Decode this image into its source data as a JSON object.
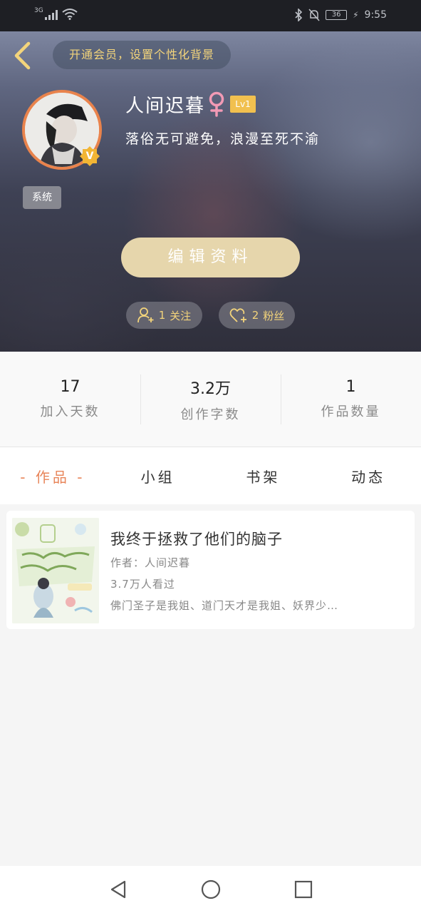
{
  "status_bar": {
    "network": "3G",
    "battery": "36",
    "time": "9:55"
  },
  "header": {
    "vip_promo": "开通会员，设置个性化背景"
  },
  "profile": {
    "nickname": "人间迟暮",
    "level": "Lv1",
    "signature": "落俗无可避免，浪漫至死不渝",
    "tag": "系统",
    "verified_badge": "V",
    "edit_button": "编辑资料",
    "follow_count": "1",
    "follow_label": "关注",
    "fans_count": "2",
    "fans_label": "粉丝"
  },
  "stats": [
    {
      "value": "17",
      "label": "加入天数"
    },
    {
      "value": "3.2万",
      "label": "创作字数"
    },
    {
      "value": "1",
      "label": "作品数量"
    }
  ],
  "tabs": [
    {
      "label": "- 作品 -",
      "active": true
    },
    {
      "label": "小组",
      "active": false
    },
    {
      "label": "书架",
      "active": false
    },
    {
      "label": "动态",
      "active": false
    }
  ],
  "works": [
    {
      "title": "我终于拯救了他们的脑子",
      "author": "作者：人间迟暮",
      "views": "3.7万人看过",
      "description": "佛门圣子是我姐、道门天才是我姐、妖界少…"
    }
  ],
  "colors": {
    "accent": "#e8855a",
    "gold": "#f3d47b",
    "edit_button": "#e6d6ac",
    "level_badge": "#f1c04f"
  },
  "icons": {
    "back": "chevron-left-icon",
    "gender": "female-icon",
    "follow": "add-user-icon",
    "fans": "add-heart-icon",
    "verified": "verified-badge-icon"
  }
}
